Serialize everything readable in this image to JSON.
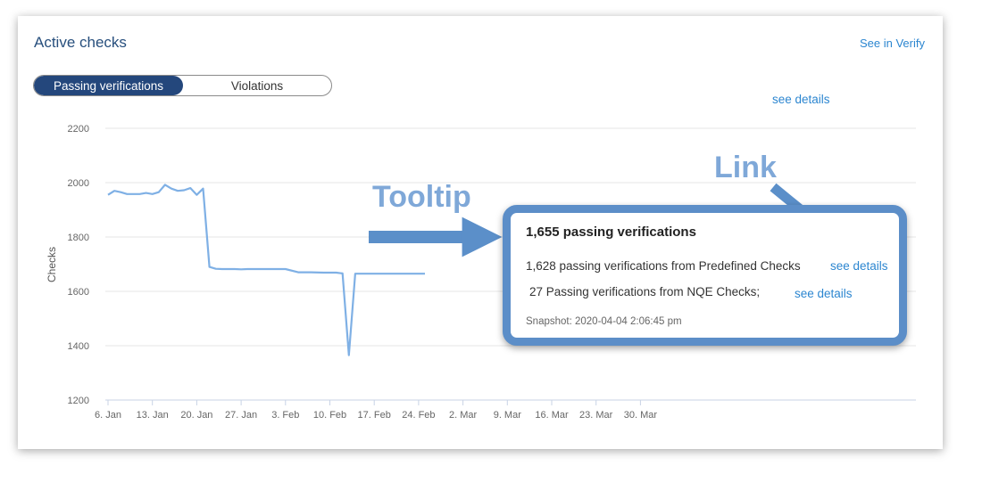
{
  "header": {
    "title": "Active checks",
    "verify_link": "See in Verify"
  },
  "toggle": {
    "options": [
      "Passing verifications",
      "Violations"
    ],
    "selected": "Passing verifications"
  },
  "top_link": "see details",
  "tooltip": {
    "title": "1,655 passing verifications",
    "line1": "1,628 passing verifications from Predefined Checks",
    "line1_link": "see details",
    "line2": "27 Passing verifications from NQE Checks;",
    "line2_link": "see details",
    "snapshot": "Snapshot: 2020-04-04  2:06:45 pm"
  },
  "annotations": {
    "tooltip_label": "Tooltip",
    "link_label": "Link",
    "arrow_color": "#5b8fc9",
    "label_color": "#7fa8d8"
  },
  "colors": {
    "accent": "#24477c",
    "link": "#2c86d0",
    "line": "#7fb0e5"
  },
  "chart_data": {
    "type": "line",
    "ylabel": "Checks",
    "ylim": [
      1200,
      2200
    ],
    "yticks": [
      2200,
      2000,
      1800,
      1600,
      1400,
      1200
    ],
    "xticks": [
      "6. Jan",
      "13. Jan",
      "20. Jan",
      "27. Jan",
      "3. Feb",
      "10. Feb",
      "17. Feb",
      "24. Feb",
      "2. Mar",
      "9. Mar",
      "16. Mar",
      "23. Mar",
      "30. Mar"
    ],
    "grid": true,
    "series": [
      {
        "x": [
          "2020-01-06",
          "2020-01-07",
          "2020-01-08",
          "2020-01-09",
          "2020-01-10",
          "2020-01-11",
          "2020-01-12",
          "2020-01-13",
          "2020-01-14",
          "2020-01-15",
          "2020-01-16",
          "2020-01-17",
          "2020-01-18",
          "2020-01-19",
          "2020-01-20",
          "2020-01-21",
          "2020-01-22",
          "2020-01-23",
          "2020-01-24",
          "2020-01-25",
          "2020-01-26",
          "2020-01-27",
          "2020-01-28",
          "2020-01-30",
          "2020-02-01",
          "2020-02-03",
          "2020-02-05",
          "2020-02-07",
          "2020-02-09",
          "2020-02-11",
          "2020-02-12",
          "2020-02-13",
          "2020-02-14",
          "2020-02-15",
          "2020-02-16",
          "2020-02-17",
          "2020-02-18",
          "2020-02-19",
          "2020-02-20",
          "2020-02-21",
          "2020-02-22",
          "2020-02-23",
          "2020-04-04"
        ],
        "y": [
          1955,
          1970,
          1965,
          1958,
          1958,
          1958,
          1962,
          1958,
          1965,
          1992,
          1978,
          1970,
          1972,
          1980,
          1955,
          1978,
          1690,
          1683,
          1682,
          1682,
          1682,
          1681,
          1682,
          1682,
          1682,
          1682,
          1670,
          1670,
          1669,
          1669,
          1666,
          1365,
          1665,
          1665,
          1665,
          1665,
          1665,
          1665,
          1665,
          1665,
          1665,
          1665,
          1655
        ]
      }
    ],
    "highlight": {
      "x": "2020-04-04",
      "y": 1655
    }
  }
}
